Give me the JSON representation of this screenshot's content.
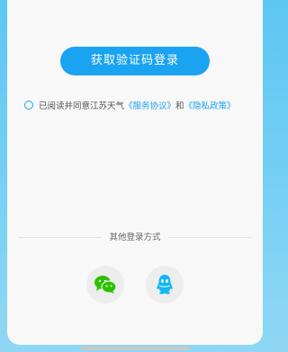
{
  "login": {
    "button_label": "获取验证码登录"
  },
  "agreement": {
    "prefix": "已阅读并同意江苏天气",
    "service_link": "《服务协议》",
    "conjunction": "和",
    "privacy_link": "《隐私政策》"
  },
  "other_login": {
    "title": "其他登录方式",
    "options": [
      {
        "icon": "wechat-icon",
        "color": "#2dc100"
      },
      {
        "icon": "qq-icon",
        "color": "#12b7f5"
      }
    ]
  }
}
